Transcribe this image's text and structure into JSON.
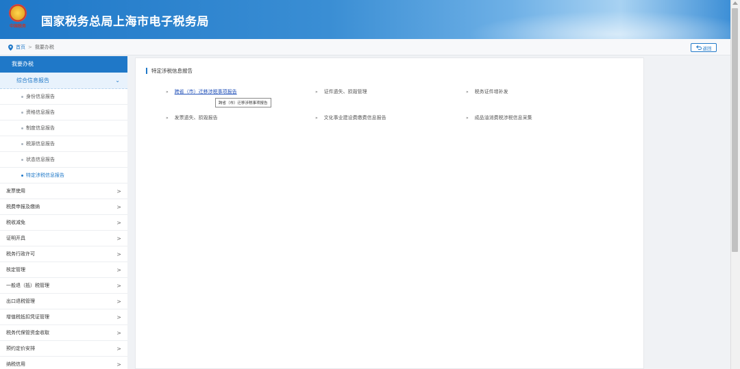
{
  "header": {
    "title": "国家税务总局上海市电子税务局",
    "emblem_text": "中国税务"
  },
  "breadcrumb": {
    "home": "首页",
    "separator": ">",
    "current": "我要办税"
  },
  "back_button": {
    "label": "返回"
  },
  "sidebar": {
    "heading": "我要办税",
    "group": {
      "label": "综合信息报告",
      "chevron": "⌄"
    },
    "sub_items": [
      "身份信息报告",
      "资格信息报告",
      "制度信息报告",
      "税源信息报告",
      "状态信息报告",
      "特定涉税信息报告"
    ],
    "active_sub": "特定涉税信息报告",
    "items": [
      "发票使用",
      "税费申报及缴纳",
      "税收减免",
      "证明开具",
      "税务行政许可",
      "核定管理",
      "一般退（抵）税管理",
      "出口退税管理",
      "增值税抵扣凭证管理",
      "税务代保管资金收取",
      "预约定价安排",
      "纳税信用"
    ],
    "arrow": ">"
  },
  "content": {
    "section_title": "特定涉税信息报告",
    "links": [
      "跨省（市）迁移涉税事项报告",
      "证件遗失、损毁管理",
      "税务证件增补发",
      "发票遗失、损毁报告",
      "文化事业建设费缴费信息报告",
      "成品油消费税涉税信息采集"
    ],
    "marker": "»",
    "tooltip": "跨省（市）迁移涉税事项报告"
  },
  "colors": {
    "accent": "#1f78c8",
    "link": "#1f4fb8"
  }
}
